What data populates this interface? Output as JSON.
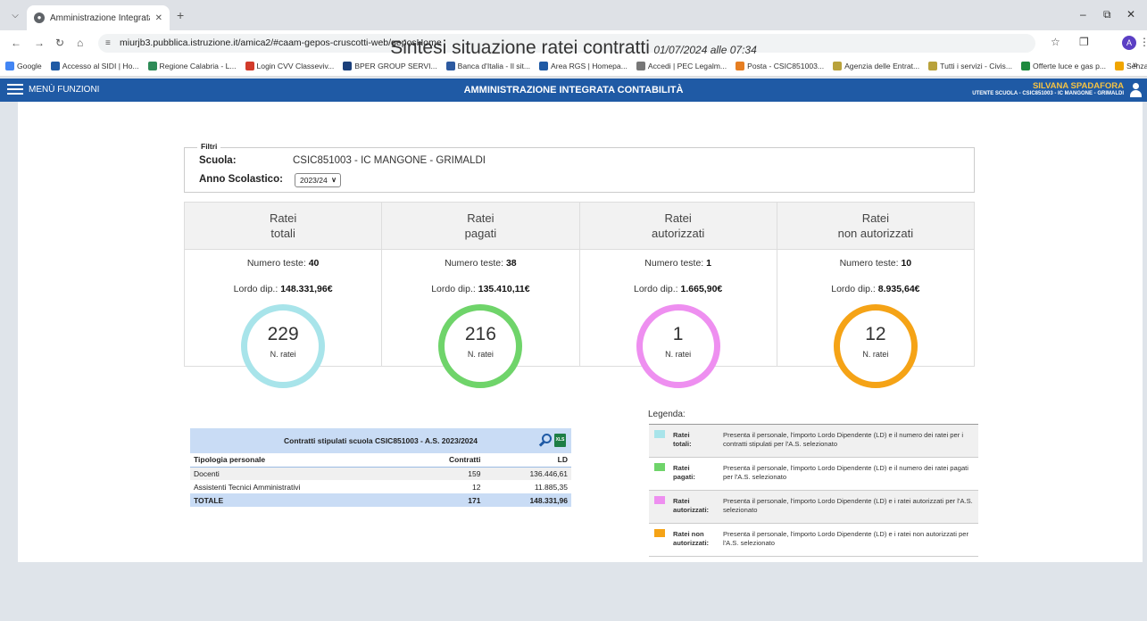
{
  "browser": {
    "tab_title": "Amministrazione Integrata Con",
    "url": "miurjb3.pubblica.istruzione.it/amica2/#caam-gepos-cruscotti-web/geposHome",
    "profile_initial": "A",
    "bookmarks": [
      {
        "label": "Google",
        "color": "#4285f4"
      },
      {
        "label": "Accesso al SIDI | Ho...",
        "color": "#1f5aa5"
      },
      {
        "label": "Regione Calabria - L...",
        "color": "#2e8b57"
      },
      {
        "label": "Login CVV Classeviv...",
        "color": "#d23b2b"
      },
      {
        "label": "BPER GROUP SERVI...",
        "color": "#1b3f7a"
      },
      {
        "label": "Banca d'Italia - Il sit...",
        "color": "#2d5aa0"
      },
      {
        "label": "Area RGS | Homepa...",
        "color": "#1f5aa5"
      },
      {
        "label": "Accedi | PEC Legalm...",
        "color": "#777777"
      },
      {
        "label": "Posta - CSIC851003...",
        "color": "#e67e22"
      },
      {
        "label": "Agenzia delle Entrat...",
        "color": "#b9a23b"
      },
      {
        "label": "Tutti i servizi - Civis...",
        "color": "#b9a23b"
      },
      {
        "label": "Offerte luce e gas p...",
        "color": "#1e8a3e"
      },
      {
        "label": "Senzalice.it",
        "color": "#f0a500"
      }
    ]
  },
  "header": {
    "menu_label": "MENÙ FUNZIONI",
    "title": "AMMINISTRAZIONE INTEGRATA CONTABILITÀ",
    "user_name": "SILVANA SPADAFORA",
    "user_role": "UTENTE SCUOLA - CSIC851003 - IC MANGONE - GRIMALDI"
  },
  "page": {
    "title": "Sintesi situazione ratei contratti",
    "datetime": "01/07/2024 alle 07:34"
  },
  "filters": {
    "legend": "Filtri",
    "scuola_label": "Scuola:",
    "scuola_value": "CSIC851003 - IC MANGONE - GRIMALDI",
    "anno_label": "Anno Scolastico:",
    "anno_value": "2023/24"
  },
  "cards": [
    {
      "title_1": "Ratei",
      "title_2": "totali",
      "teste_label": "Numero teste:",
      "teste": "40",
      "lordo_label": "Lordo dip.:",
      "lordo": "148.331,96€",
      "ratei": "229",
      "ratei_label": "N. ratei",
      "color": "#a8e4ea"
    },
    {
      "title_1": "Ratei",
      "title_2": "pagati",
      "teste_label": "Numero teste:",
      "teste": "38",
      "lordo_label": "Lordo dip.:",
      "lordo": "135.410,11€",
      "ratei": "216",
      "ratei_label": "N. ratei",
      "color": "#6fd46a"
    },
    {
      "title_1": "Ratei",
      "title_2": "autorizzati",
      "teste_label": "Numero teste:",
      "teste": "1",
      "lordo_label": "Lordo dip.:",
      "lordo": "1.665,90€",
      "ratei": "1",
      "ratei_label": "N. ratei",
      "color": "#ee8ff0"
    },
    {
      "title_1": "Ratei",
      "title_2": "non autorizzati",
      "teste_label": "Numero teste:",
      "teste": "10",
      "lordo_label": "Lordo dip.:",
      "lordo": "8.935,64€",
      "ratei": "12",
      "ratei_label": "N. ratei",
      "color": "#f5a316"
    }
  ],
  "contracts_table": {
    "title": "Contratti stipulati scuola CSIC851003 - A.S. 2023/2024",
    "excel_label": "XLS",
    "headers": [
      "Tipologia personale",
      "Contratti",
      "LD"
    ],
    "rows": [
      [
        "Docenti",
        "159",
        "136.446,61"
      ],
      [
        "Assistenti Tecnici Amministrativi",
        "12",
        "11.885,35"
      ]
    ],
    "total": [
      "TOTALE",
      "171",
      "148.331,96"
    ]
  },
  "legend": {
    "title": "Legenda:",
    "items": [
      {
        "name_1": "Ratei",
        "name_2": "totali:",
        "desc": "Presenta il personale, l'importo Lordo Dipendente (LD) e il numero dei ratei per i contratti stipulati per l'A.S. selezionato",
        "color": "#a8e4ea"
      },
      {
        "name_1": "Ratei",
        "name_2": "pagati:",
        "desc": "Presenta il personale, l'importo Lordo Dipendente (LD) e il numero dei ratei pagati per l'A.S. selezionato",
        "color": "#6fd46a"
      },
      {
        "name_1": "Ratei",
        "name_2": "autorizzati:",
        "desc": "Presenta il personale, l'importo Lordo Dipendente (LD) e i ratei autorizzati per l'A.S. selezionato",
        "color": "#ee8ff0"
      },
      {
        "name_1": "Ratei non",
        "name_2": "autorizzati:",
        "desc": "Presenta il personale, l'importo Lordo Dipendente (LD) e i ratei non autorizzati per l'A.S. selezionato",
        "color": "#f5a316"
      }
    ]
  }
}
